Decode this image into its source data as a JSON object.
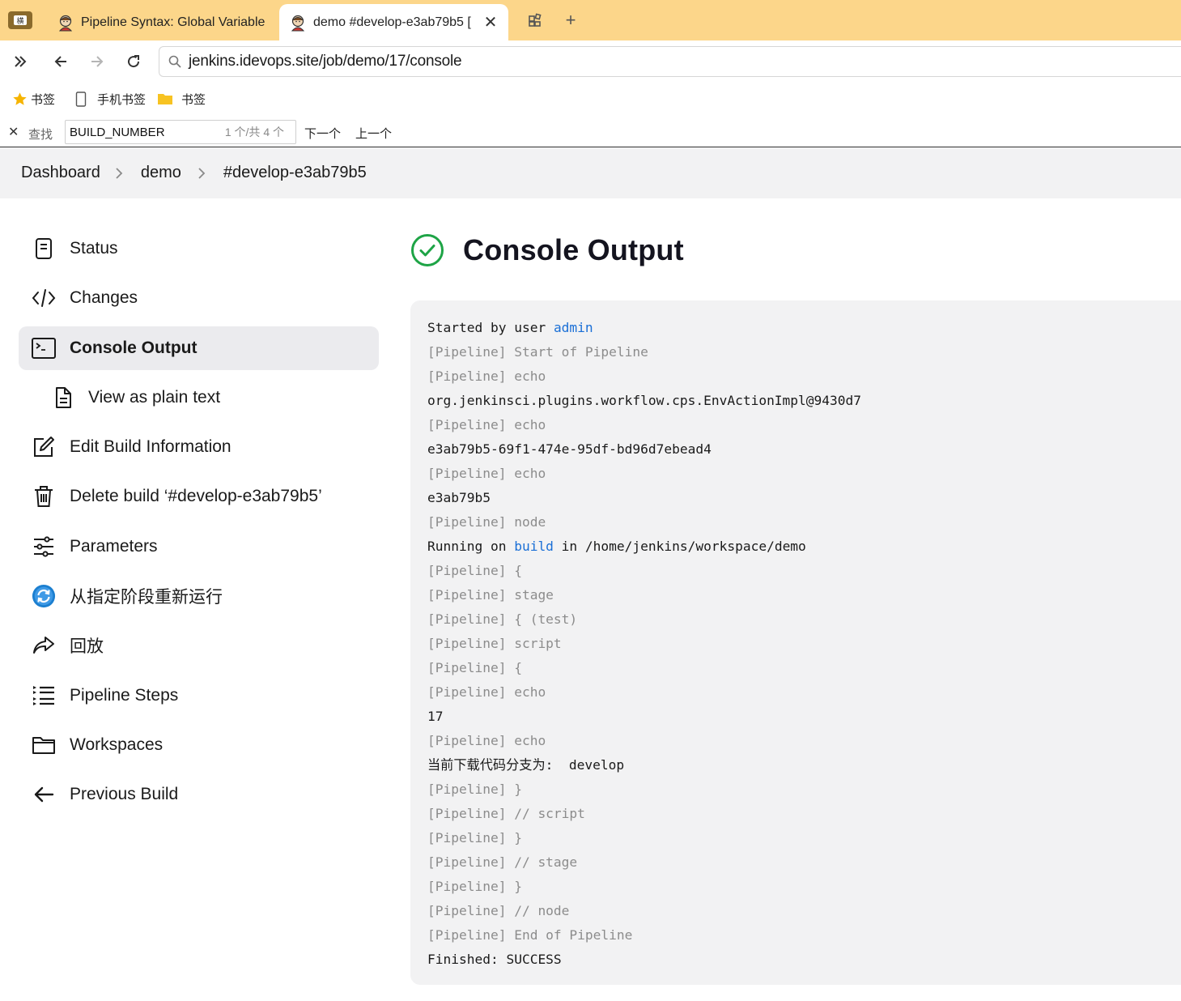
{
  "browser": {
    "side_button_label": "横",
    "tabs": [
      {
        "title": "Pipeline Syntax: Global Variable",
        "active": false
      },
      {
        "title": "demo #develop-e3ab79b5 [",
        "active": true
      }
    ],
    "new_tab_label": "+",
    "url": "jenkins.idevops.site/job/demo/17/console",
    "bookmarks": [
      {
        "label": "书签",
        "icon": "star-icon"
      },
      {
        "label": "手机书签",
        "icon": "phone-icon"
      },
      {
        "label": "书签",
        "icon": "folder-icon"
      }
    ],
    "find": {
      "close_glyph": "✕",
      "label": "查找",
      "query": "BUILD_NUMBER",
      "count": "1 个/共 4 个",
      "next_label": "下一个",
      "prev_label": "上一个"
    }
  },
  "breadcrumb": [
    "Dashboard",
    "demo",
    "#develop-e3ab79b5"
  ],
  "sidebar": {
    "items": [
      {
        "label": "Status",
        "icon": "notepad-icon"
      },
      {
        "label": "Changes",
        "icon": "code-icon"
      },
      {
        "label": "Console Output",
        "icon": "terminal-icon",
        "active": true
      },
      {
        "label": "View as plain text",
        "icon": "document-icon",
        "sub": true
      },
      {
        "label": "Edit Build Information",
        "icon": "edit-icon"
      },
      {
        "label": "Delete build ‘#develop-e3ab79b5’",
        "icon": "trash-icon"
      },
      {
        "label": "Parameters",
        "icon": "sliders-icon"
      },
      {
        "label": "从指定阶段重新运行",
        "icon": "restart-icon"
      },
      {
        "label": "回放",
        "icon": "replay-icon"
      },
      {
        "label": "Pipeline Steps",
        "icon": "steps-icon"
      },
      {
        "label": "Workspaces",
        "icon": "folder-icon"
      },
      {
        "label": "Previous Build",
        "icon": "arrow-left-icon"
      }
    ]
  },
  "main": {
    "title": "Console Output",
    "status_icon": "success-check-icon",
    "status_color": "#1ea446"
  },
  "console": {
    "lines": [
      {
        "text": "Started by user ",
        "link": "admin"
      },
      {
        "text": "[Pipeline] Start of Pipeline",
        "dim": true
      },
      {
        "text": "[Pipeline] echo",
        "dim": true
      },
      {
        "text": "org.jenkinsci.plugins.workflow.cps.EnvActionImpl@9430d7"
      },
      {
        "text": "[Pipeline] echo",
        "dim": true
      },
      {
        "text": "e3ab79b5-69f1-474e-95df-bd96d7ebead4"
      },
      {
        "text": "[Pipeline] echo",
        "dim": true
      },
      {
        "text": "e3ab79b5"
      },
      {
        "text": "[Pipeline] node",
        "dim": true
      },
      {
        "text": "Running on ",
        "link": "build",
        "after": " in /home/jenkins/workspace/demo"
      },
      {
        "text": "[Pipeline] {",
        "dim": true
      },
      {
        "text": "[Pipeline] stage",
        "dim": true
      },
      {
        "text": "[Pipeline] { (test)",
        "dim": true
      },
      {
        "text": "[Pipeline] script",
        "dim": true
      },
      {
        "text": "[Pipeline] {",
        "dim": true
      },
      {
        "text": "[Pipeline] echo",
        "dim": true
      },
      {
        "text": "17"
      },
      {
        "text": "[Pipeline] echo",
        "dim": true
      },
      {
        "text": "当前下载代码分支为:  develop"
      },
      {
        "text": "[Pipeline] }",
        "dim": true
      },
      {
        "text": "[Pipeline] // script",
        "dim": true
      },
      {
        "text": "[Pipeline] }",
        "dim": true
      },
      {
        "text": "[Pipeline] // stage",
        "dim": true
      },
      {
        "text": "[Pipeline] }",
        "dim": true
      },
      {
        "text": "[Pipeline] // node",
        "dim": true
      },
      {
        "text": "[Pipeline] End of Pipeline",
        "dim": true
      },
      {
        "text": "Finished: SUCCESS"
      }
    ],
    "link_color": "#1a6fd6"
  }
}
